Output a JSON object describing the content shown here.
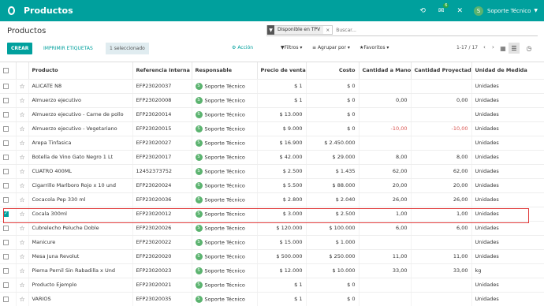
{
  "navbar": {
    "app_title": "Productos",
    "chat_badge": "6",
    "user_initial": "S",
    "user_name": "Soporte Técnico"
  },
  "control_panel": {
    "breadcrumb": "Productos",
    "facet_value": "Disponible en TPV",
    "search_placeholder": "Buscar...",
    "create_label": "CREAR",
    "print_labels": "IMPRIMIR ETIQUETAS",
    "selected_label": "1 seleccionado",
    "action_label": "Acción",
    "filters_label": "Filtros",
    "group_label": "Agrupar por",
    "favorites_label": "Favoritos",
    "pager": "1-17 / 17"
  },
  "table": {
    "headers": [
      "Producto",
      "Referencia Interna",
      "Responsable",
      "Precio de venta",
      "Costo",
      "Cantidad a Mano",
      "Cantidad Proyectada",
      "Unidad de Medida"
    ],
    "rows": [
      {
        "name": "ALICATE N8",
        "ref": "EFP23020037",
        "resp": "Soporte Técnico",
        "price": "$ 1",
        "cost": "$ 0",
        "qty": "",
        "proj": "",
        "uom": "Unidades",
        "checked": false
      },
      {
        "name": "Almuerzo ejecutivo",
        "ref": "EFP23020008",
        "resp": "Soporte Técnico",
        "price": "$ 1",
        "cost": "$ 0",
        "qty": "0,00",
        "proj": "0,00",
        "uom": "Unidades",
        "checked": false
      },
      {
        "name": "Almuerzo ejecutivo - Carne de pollo",
        "ref": "EFP23020014",
        "resp": "Soporte Técnico",
        "price": "$ 13.000",
        "cost": "$ 0",
        "qty": "",
        "proj": "",
        "uom": "Unidades",
        "checked": false
      },
      {
        "name": "Almuerzo ejecutivo - Vegetariano",
        "ref": "EFP23020015",
        "resp": "Soporte Técnico",
        "price": "$ 9.000",
        "cost": "$ 0",
        "qty": "-10,00",
        "proj": "-10,00",
        "uom": "Unidades",
        "checked": false
      },
      {
        "name": "Arepa Tinfasica",
        "ref": "EFP23020027",
        "resp": "Soporte Técnico",
        "price": "$ 16.900",
        "cost": "$ 2.450.000",
        "qty": "",
        "proj": "",
        "uom": "Unidades",
        "checked": false
      },
      {
        "name": "Botella de Vino Gato Negro 1 Lt",
        "ref": "EFP23020017",
        "resp": "Soporte Técnico",
        "price": "$ 42.000",
        "cost": "$ 29.000",
        "qty": "8,00",
        "proj": "8,00",
        "uom": "Unidades",
        "checked": false
      },
      {
        "name": "CUATRO 400ML",
        "ref": "12452373752",
        "resp": "Soporte Técnico",
        "price": "$ 2.500",
        "cost": "$ 1.435",
        "qty": "62,00",
        "proj": "62,00",
        "uom": "Unidades",
        "checked": false
      },
      {
        "name": "Cigarrillo Marlboro Rojo x 10 und",
        "ref": "EFP23020024",
        "resp": "Soporte Técnico",
        "price": "$ 5.500",
        "cost": "$ 88.000",
        "qty": "20,00",
        "proj": "20,00",
        "uom": "Unidades",
        "checked": false
      },
      {
        "name": "Cocacola Pep 330 ml",
        "ref": "EFP23020036",
        "resp": "Soporte Técnico",
        "price": "$ 2.800",
        "cost": "$ 2.040",
        "qty": "26,00",
        "proj": "26,00",
        "uom": "Unidades",
        "checked": false
      },
      {
        "name": "Cocala 300ml",
        "ref": "EFP23020012",
        "resp": "Soporte Técnico",
        "price": "$ 3.000",
        "cost": "$ 2.500",
        "qty": "1,00",
        "proj": "1,00",
        "uom": "Unidades",
        "checked": true
      },
      {
        "name": "Cubrelecho Peluche Doble",
        "ref": "EFP23020026",
        "resp": "Soporte Técnico",
        "price": "$ 120.000",
        "cost": "$ 100.000",
        "qty": "6,00",
        "proj": "6,00",
        "uom": "Unidades",
        "checked": false
      },
      {
        "name": "Manicure",
        "ref": "EFP23020022",
        "resp": "Soporte Técnico",
        "price": "$ 15.000",
        "cost": "$ 1.000",
        "qty": "",
        "proj": "",
        "uom": "Unidades",
        "checked": false
      },
      {
        "name": "Mesa Juna Revolut",
        "ref": "EFP23020020",
        "resp": "Soporte Técnico",
        "price": "$ 500.000",
        "cost": "$ 250.000",
        "qty": "11,00",
        "proj": "11,00",
        "uom": "Unidades",
        "checked": false
      },
      {
        "name": "Pierna Pernil Sin Rabadilla x Und",
        "ref": "EFP23020023",
        "resp": "Soporte Técnico",
        "price": "$ 12.000",
        "cost": "$ 10.000",
        "qty": "33,00",
        "proj": "33,00",
        "uom": "kg",
        "checked": false
      },
      {
        "name": "Producto Ejemplo",
        "ref": "EFP23020021",
        "resp": "Soporte Técnico",
        "price": "$ 1",
        "cost": "$ 0",
        "qty": "",
        "proj": "",
        "uom": "Unidades",
        "checked": false
      },
      {
        "name": "VARIOS",
        "ref": "EFP23020035",
        "resp": "Soporte Técnico",
        "price": "$ 1",
        "cost": "$ 0",
        "qty": "",
        "proj": "",
        "uom": "Unidades",
        "checked": false
      }
    ]
  },
  "colors": {
    "brand": "#00a09d",
    "highlight": "#e03b3b"
  }
}
